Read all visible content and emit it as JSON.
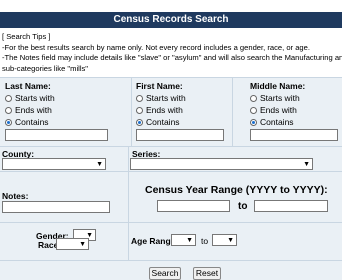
{
  "header": {
    "title": "Census Records Search"
  },
  "tips": {
    "heading": "[ Search Tips ]",
    "line1": "-For the best results search by name only. Not every record includes a gender, race, or age.",
    "line2": "-The Notes field may include details like \"slave\" or \"asylum\" and will also search the Manufacturing and Indu",
    "line3": "sub-categories like \"mills\""
  },
  "name_fields": {
    "last": {
      "label": "Last Name:",
      "value": ""
    },
    "first": {
      "label": "First Name:",
      "value": ""
    },
    "middle": {
      "label": "Middle Name:",
      "value": ""
    },
    "options": [
      "Starts with",
      "Ends with",
      "Contains"
    ],
    "selected_option": "Contains"
  },
  "county": {
    "label": "County:",
    "value": ""
  },
  "series": {
    "label": "Series:",
    "value": ""
  },
  "notes": {
    "label": "Notes:",
    "value": ""
  },
  "census_year": {
    "label": "Census Year Range (YYYY to YYYY):",
    "to_label": "to",
    "from": "",
    "to": ""
  },
  "gender": {
    "label": "Gender:",
    "value": ""
  },
  "race": {
    "label": "Race:",
    "value": ""
  },
  "age_range": {
    "label": "Age Range:",
    "to_label": "to",
    "from": "",
    "to": ""
  },
  "buttons": {
    "search": "Search",
    "reset": "Reset"
  },
  "colors": {
    "header_bg": "#1f3a5f",
    "panel_bg": "#eaf0f5",
    "radio_selected": "#1a6fd0"
  }
}
